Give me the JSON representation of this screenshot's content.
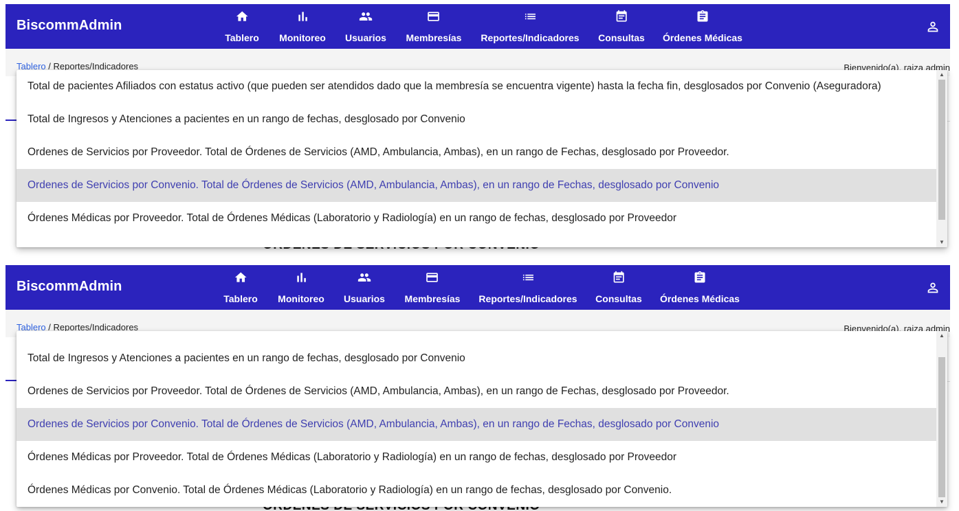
{
  "app": {
    "brand": "BiscommAdmin"
  },
  "nav": [
    {
      "label": "Tablero",
      "icon": "home-icon"
    },
    {
      "label": "Monitoreo",
      "icon": "bar-chart-icon"
    },
    {
      "label": "Usuarios",
      "icon": "people-icon"
    },
    {
      "label": "Membresías",
      "icon": "credit-card-icon"
    },
    {
      "label": "Reportes/Indicadores",
      "icon": "list-icon"
    },
    {
      "label": "Consultas",
      "icon": "calendar-icon"
    },
    {
      "label": "Órdenes Médicas",
      "icon": "clipboard-icon"
    }
  ],
  "user_icon": "account-icon",
  "breadcrumb": {
    "home": "Tablero",
    "separator": " / ",
    "current": "Reportes/Indicadores"
  },
  "welcome": "Bienvenido(a), raiza admin",
  "background_title": "ÓRDENES DE SERVICIOS POR CONVENIO",
  "panel1": {
    "options": [
      "Total de pacientes Afiliados con estatus activo (que pueden ser atendidos dado que la membresía se encuentra vigente) hasta la fecha fin, desglosados por Convenio (Aseguradora)",
      "Total de Ingresos y Atenciones a pacientes en un rango de fechas, desglosado por Convenio",
      "Ordenes de Servicios por Proveedor. Total de Órdenes de Servicios (AMD, Ambulancia, Ambas), en un rango de Fechas, desglosado por Proveedor.",
      "Ordenes de Servicios por Convenio. Total de Órdenes de Servicios (AMD, Ambulancia, Ambas), en un rango de Fechas, desglosado por Convenio",
      "Órdenes Médicas por Proveedor. Total de Órdenes Médicas (Laboratorio y Radiología) en un rango de fechas, desglosado por Proveedor"
    ],
    "selected_index": 3
  },
  "panel2": {
    "options": [
      "Total de Ingresos y Atenciones a pacientes en un rango de fechas, desglosado por Convenio",
      "Ordenes de Servicios por Proveedor. Total de Órdenes de Servicios (AMD, Ambulancia, Ambas), en un rango de Fechas, desglosado por Proveedor.",
      "Ordenes de Servicios por Convenio. Total de Órdenes de Servicios (AMD, Ambulancia, Ambas), en un rango de Fechas, desglosado por Convenio",
      "Órdenes Médicas por Proveedor. Total de Órdenes Médicas (Laboratorio y Radiología) en un rango de fechas, desglosado por Proveedor",
      "Órdenes Médicas por Convenio. Total de Órdenes Médicas (Laboratorio y Radiología) en un rango de fechas, desglosado por Convenio."
    ],
    "selected_index": 2
  },
  "colors": {
    "topbar": "#2b23bd",
    "selected_text": "#3f3fb0",
    "link": "#2f62e0"
  }
}
